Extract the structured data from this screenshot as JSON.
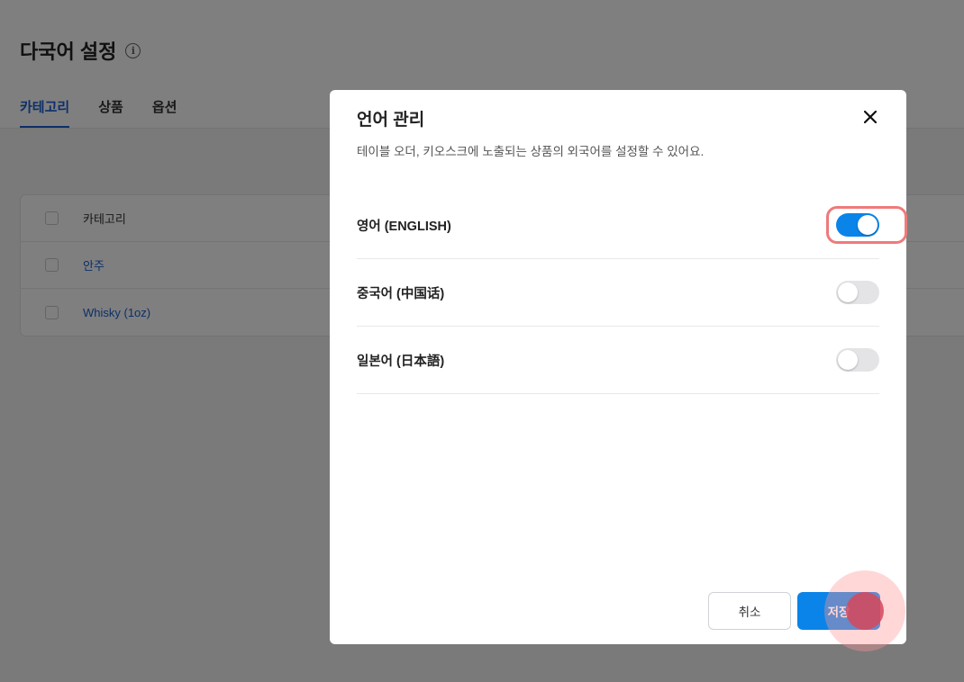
{
  "page": {
    "title": "다국어 설정",
    "tabs": [
      {
        "label": "카테고리",
        "active": true
      },
      {
        "label": "상품",
        "active": false
      },
      {
        "label": "옵션",
        "active": false
      }
    ],
    "table": {
      "header": "카테고리",
      "rows": [
        "안주",
        "Whisky (1oz)"
      ]
    }
  },
  "modal": {
    "title": "언어 관리",
    "description": "테이블 오더, 키오스크에 노출되는 상품의 외국어를 설정할 수 있어요.",
    "languages": [
      {
        "label": "영어 (ENGLISH)",
        "enabled": true
      },
      {
        "label": "중국어 (中国话)",
        "enabled": false
      },
      {
        "label": "일본어 (日本語)",
        "enabled": false
      }
    ],
    "cancel_label": "취소",
    "save_label": "저장"
  },
  "colors": {
    "accent": "#0a84e8",
    "tab_active": "#1a5fd0",
    "highlight": "#f07a7a"
  },
  "icons": {
    "info": "info-icon",
    "close": "close-icon"
  }
}
